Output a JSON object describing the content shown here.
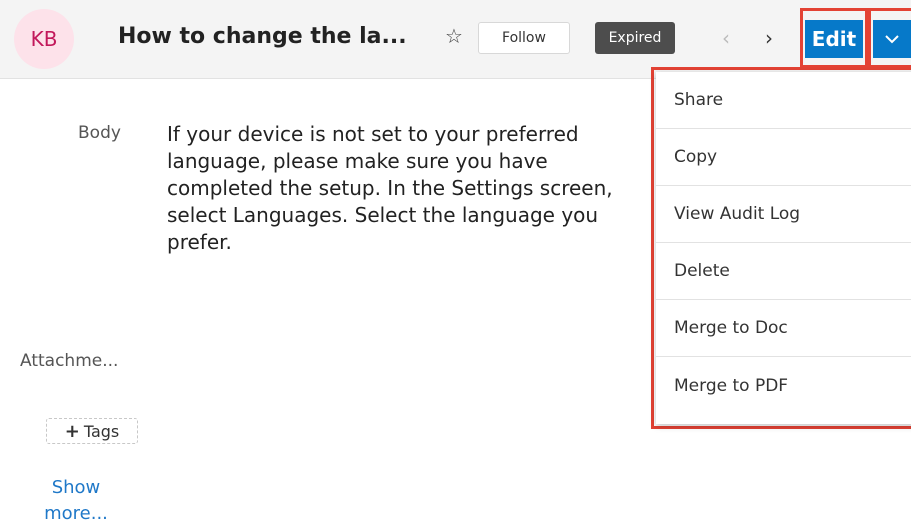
{
  "header": {
    "avatar_text": "KB",
    "title": "How to change the la...",
    "follow_label": "Follow",
    "status_badge": "Expired",
    "edit_label": "Edit"
  },
  "record": {
    "body_label": "Body",
    "body_text": "If your device is not set to your preferred language, please make sure you have completed the setup. In the Settings screen, select Languages. Select the language you prefer.",
    "attachments_label": "Attachme...",
    "tags_label": "Tags",
    "show_more_label": "Show more..."
  },
  "menu": {
    "items": [
      {
        "label": "Share"
      },
      {
        "label": "Copy"
      },
      {
        "label": "View Audit Log"
      },
      {
        "label": "Delete"
      },
      {
        "label": "Merge to Doc"
      },
      {
        "label": "Merge to PDF"
      }
    ]
  },
  "colors": {
    "primary": "#0679c9",
    "highlight": "#e34234",
    "expired_badge": "#4d4d4d",
    "avatar_bg": "#fde2ea",
    "link": "#1f78c8"
  },
  "icons": {
    "favorite": "star-outline-icon",
    "previous": "chevron-left-icon",
    "next": "chevron-right-icon",
    "actions": "chevron-down-icon",
    "add": "plus-icon"
  }
}
